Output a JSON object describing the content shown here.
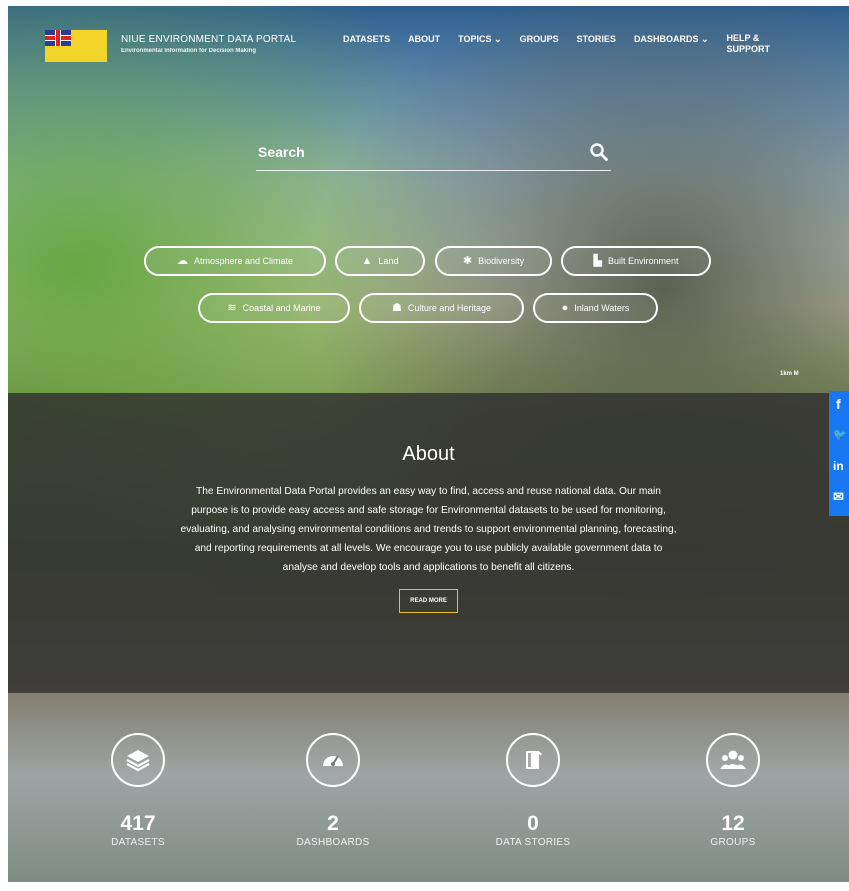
{
  "header": {
    "title": "NIUE ENVIRONMENT DATA PORTAL",
    "subtitle": "Environmental Information for Decision Making",
    "nav": [
      {
        "label": "DATASETS",
        "has_dropdown": false
      },
      {
        "label": "ABOUT",
        "has_dropdown": false
      },
      {
        "label": "TOPICS ⌄",
        "has_dropdown": true
      },
      {
        "label": "GROUPS",
        "has_dropdown": false
      },
      {
        "label": "STORIES",
        "has_dropdown": false
      },
      {
        "label": "DASHBOARDS ⌄",
        "has_dropdown": true
      },
      {
        "label_line1": "HELP &",
        "label_line2": "SUPPORT"
      }
    ]
  },
  "search": {
    "placeholder": "Search",
    "icon": "search-icon"
  },
  "topics": [
    {
      "label": "Atmosphere and Climate",
      "icon": "cloud-icon"
    },
    {
      "label": "Land",
      "icon": "mountain-icon"
    },
    {
      "label": "Biodiversity",
      "icon": "leaf-icon"
    },
    {
      "label": "Built Environment",
      "icon": "building-icon"
    },
    {
      "label": "Coastal and Marine",
      "icon": "wave-icon"
    },
    {
      "label": "Culture and Heritage",
      "icon": "people-icon"
    },
    {
      "label": "Inland Waters",
      "icon": "droplet-icon"
    }
  ],
  "map_label": "1km M",
  "about": {
    "heading": "About",
    "text": "The Environmental Data Portal provides an easy way to find, access and reuse national data. Our main purpose is to provide easy access and safe storage for Environmental datasets to be used for monitoring, evaluating, and analysing environmental conditions and trends to support environmental planning, forecasting, and reporting requirements at all levels. We encourage you to use publicly available government data to analyse and develop tools and applications to benefit all citizens.",
    "button": "READ MORE"
  },
  "social": [
    {
      "icon": "facebook-icon",
      "glyph": "f"
    },
    {
      "icon": "twitter-icon",
      "glyph": "🐦"
    },
    {
      "icon": "linkedin-icon",
      "glyph": "in"
    },
    {
      "icon": "email-icon",
      "glyph": "✉"
    }
  ],
  "stats": [
    {
      "value": "417",
      "label": "DATASETS",
      "icon": "layers-icon"
    },
    {
      "value": "2",
      "label": "DASHBOARDS",
      "icon": "gauge-icon"
    },
    {
      "value": "0",
      "label": "DATA STORIES",
      "icon": "book-icon"
    },
    {
      "value": "12",
      "label": "GROUPS",
      "icon": "group-icon"
    }
  ],
  "colors": {
    "accent_yellow": "#e8c21a",
    "social_blue": "#1877f2",
    "about_overlay": "#30302e"
  }
}
